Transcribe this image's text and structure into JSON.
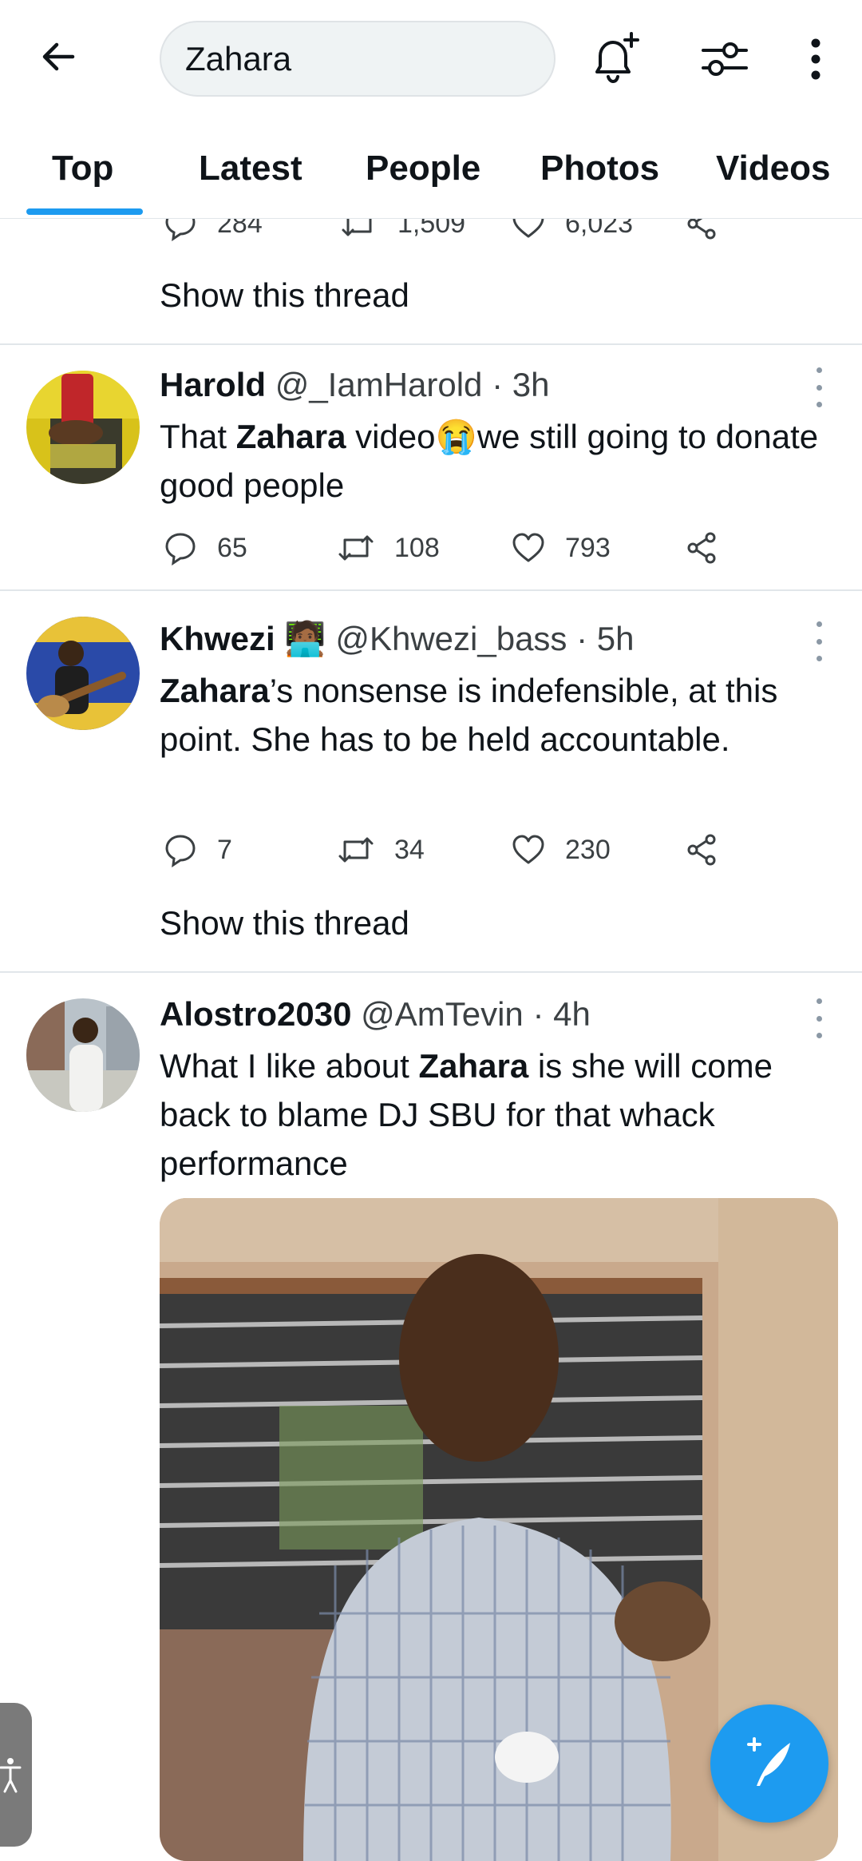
{
  "search": {
    "query": "Zahara"
  },
  "tabs": [
    {
      "label": "Top",
      "active": true
    },
    {
      "label": "Latest"
    },
    {
      "label": "People"
    },
    {
      "label": "Photos"
    },
    {
      "label": "Videos"
    }
  ],
  "prev_tweet": {
    "replies": "284",
    "retweets": "1,509",
    "likes": "6,023",
    "show_thread": "Show this thread"
  },
  "tweets": [
    {
      "name": "Harold",
      "handle": "@_IamHarold",
      "time": "· 3h",
      "text_parts": [
        "That ",
        "Zahara",
        " video",
        "😭",
        "we still going to donate good people"
      ],
      "replies": "65",
      "retweets": "108",
      "likes": "793"
    },
    {
      "name": "Khwezi",
      "name_emoji": "🧑🏾‍💻",
      "handle": "@Khwezi_bass",
      "time": "· 5h",
      "text_parts": [
        "Zahara",
        "’s nonsense is indefensible, at this point. She has to be held accountable."
      ],
      "replies": "7",
      "retweets": "34",
      "likes": "230",
      "show_thread": "Show this thread"
    },
    {
      "name": "Alostro2030",
      "handle": "@AmTevin",
      "time": "· 4h",
      "text_parts": [
        "What I like about ",
        "Zahara",
        " is she will come back to blame DJ SBU for that whack performance"
      ]
    }
  ],
  "colors": {
    "accent": "#1d9bf0",
    "text": "#0f1419",
    "secondary": "#3b4043",
    "divider": "#e1e6ea"
  },
  "icons": [
    "back-arrow-icon",
    "bell-plus-icon",
    "filter-sliders-icon",
    "more-vertical-icon",
    "reply-icon",
    "retweet-icon",
    "like-icon",
    "share-icon",
    "compose-tweet-icon",
    "accessibility-icon"
  ]
}
